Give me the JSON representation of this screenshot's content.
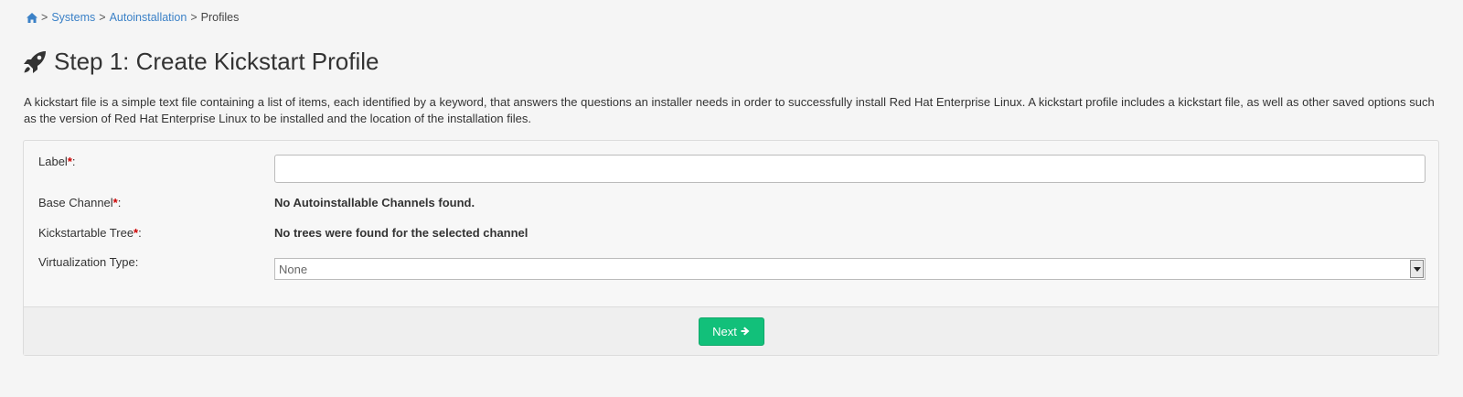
{
  "breadcrumb": {
    "home_icon": "home-icon",
    "items": [
      "Systems",
      "Autoinstallation"
    ],
    "current": "Profiles",
    "separator": ">"
  },
  "page": {
    "title": "Step 1: Create Kickstart Profile",
    "title_icon": "rocket-icon",
    "description": "A kickstart file is a simple text file containing a list of items, each identified by a keyword, that answers the questions an installer needs in order to successfully install Red Hat Enterprise Linux. A kickstart profile includes a kickstart file, as well as other saved options such as the version of Red Hat Enterprise Linux to be installed and the location of the installation files."
  },
  "form": {
    "label_field": {
      "label": "Label",
      "required_mark": "*",
      "colon": ":",
      "value": ""
    },
    "base_channel": {
      "label": "Base Channel",
      "required_mark": "*",
      "colon": ":",
      "value": "No Autoinstallable Channels found."
    },
    "kickstartable_tree": {
      "label": "Kickstartable Tree",
      "required_mark": "*",
      "colon": ":",
      "value": "No trees were found for the selected channel"
    },
    "virtualization_type": {
      "label": "Virtualization Type:",
      "selected": "None"
    },
    "next_button": "Next",
    "next_icon": "arrow-right-icon"
  },
  "colors": {
    "link": "#3b81c7",
    "primary_button": "#12c07a",
    "required": "#cc0000"
  }
}
